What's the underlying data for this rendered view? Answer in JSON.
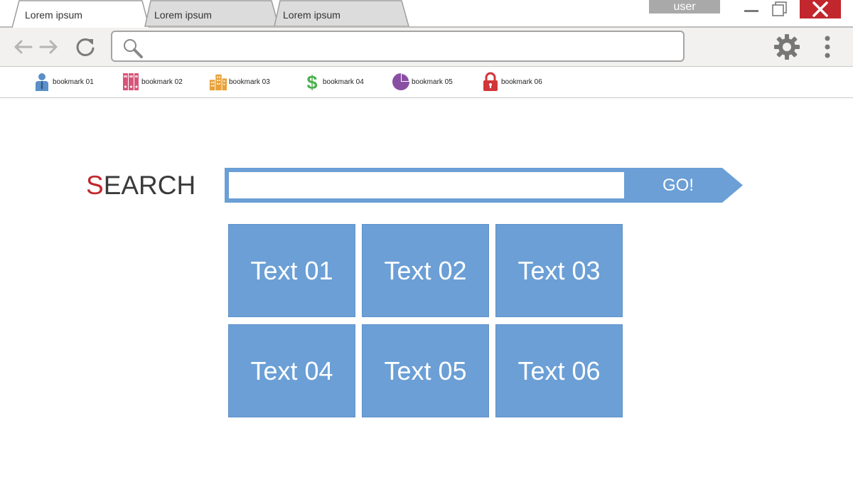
{
  "browser": {
    "tabs": [
      {
        "label": "Lorem ipsum",
        "active": true
      },
      {
        "label": "Lorem ipsum",
        "active": false
      },
      {
        "label": "Lorem ipsum",
        "active": false
      }
    ],
    "user_label": "user",
    "window_controls": [
      "minimize-icon",
      "maximize-icon",
      "close-icon"
    ],
    "close_color": "#c1272d",
    "address_bar": {
      "value": "",
      "placeholder": "",
      "icon": "search-icon"
    },
    "toolbar_icons": [
      "back-arrow-icon",
      "forward-arrow-icon",
      "reload-icon",
      "gear-icon",
      "menu-dots-icon"
    ]
  },
  "bookmarks": [
    {
      "label": "bookmark 01",
      "icon": "person-icon",
      "color": "#5b8fc7"
    },
    {
      "label": "bookmark 02",
      "icon": "binders-icon",
      "color": "#d6557a"
    },
    {
      "label": "bookmark 03",
      "icon": "buildings-icon",
      "color": "#e8a23a"
    },
    {
      "label": "bookmark 04",
      "icon": "dollar-icon",
      "color": "#4caf50"
    },
    {
      "label": "bookmark 05",
      "icon": "pie-chart-icon",
      "color": "#8a4fa3"
    },
    {
      "label": "bookmark 06",
      "icon": "padlock-icon",
      "color": "#d2363a"
    }
  ],
  "search": {
    "title_first_letter": "S",
    "title_rest": "EARCH",
    "input_value": "",
    "go_label": "GO!",
    "accent_color": "#c1272d",
    "box_color": "#6b9fd6"
  },
  "tiles": [
    "Text 01",
    "Text 02",
    "Text 03",
    "Text 04",
    "Text 05",
    "Text 06"
  ]
}
